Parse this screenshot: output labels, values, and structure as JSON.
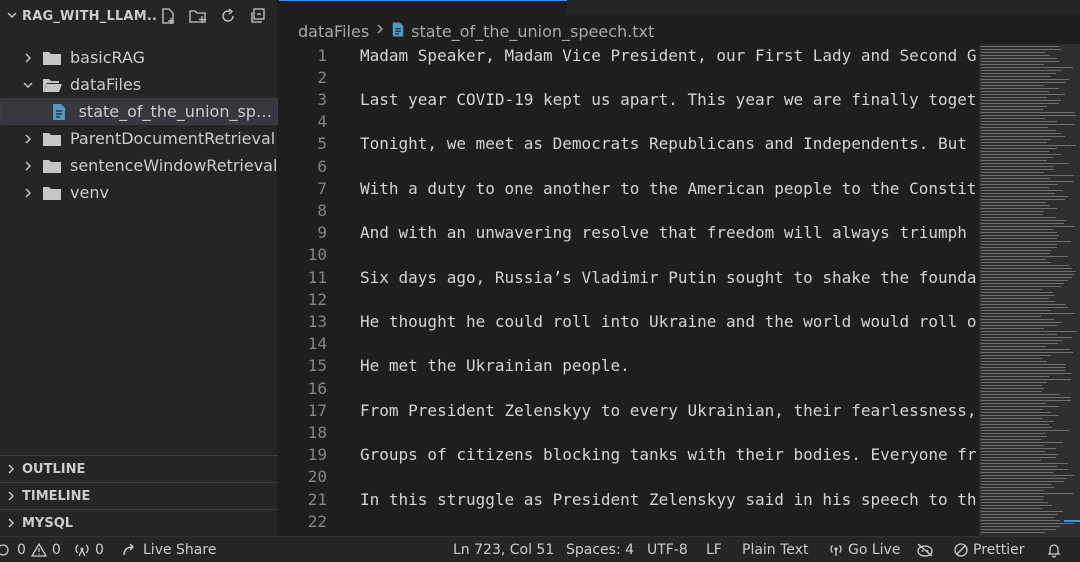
{
  "explorer": {
    "title": "RAG_WITH_LLAM...",
    "items": [
      {
        "label": "basicRAG",
        "type": "folder",
        "expanded": false
      },
      {
        "label": "dataFiles",
        "type": "folder",
        "expanded": true
      },
      {
        "label": "state_of_the_union_spe...",
        "type": "file",
        "selected": true
      },
      {
        "label": "ParentDocumentRetrieval",
        "type": "folder",
        "expanded": false
      },
      {
        "label": "sentenceWindowRetrieval",
        "type": "folder",
        "expanded": false
      },
      {
        "label": "venv",
        "type": "folder",
        "expanded": false
      }
    ]
  },
  "panels": {
    "outline": "OUTLINE",
    "timeline": "TIMELINE",
    "mysql": "MYSQL"
  },
  "breadcrumb": {
    "folder": "dataFiles",
    "file": "state_of_the_union_speech.txt"
  },
  "editor": {
    "lines": [
      {
        "n": "1",
        "text": "Madam Speaker, Madam Vice President, our First Lady and Second G"
      },
      {
        "n": "2",
        "text": ""
      },
      {
        "n": "3",
        "text": "Last year COVID-19 kept us apart. This year we are finally toget"
      },
      {
        "n": "4",
        "text": ""
      },
      {
        "n": "5",
        "text": "Tonight, we meet as Democrats Republicans and Independents. But"
      },
      {
        "n": "6",
        "text": ""
      },
      {
        "n": "7",
        "text": "With a duty to one another to the American people to the Constit"
      },
      {
        "n": "8",
        "text": ""
      },
      {
        "n": "9",
        "text": "And with an unwavering resolve that freedom will always triumph"
      },
      {
        "n": "10",
        "text": ""
      },
      {
        "n": "11",
        "text": "Six days ago, Russia’s Vladimir Putin sought to shake the founda"
      },
      {
        "n": "12",
        "text": ""
      },
      {
        "n": "13",
        "text": "He thought he could roll into Ukraine and the world would roll o"
      },
      {
        "n": "14",
        "text": ""
      },
      {
        "n": "15",
        "text": "He met the Ukrainian people."
      },
      {
        "n": "16",
        "text": ""
      },
      {
        "n": "17",
        "text": "From President Zelenskyy to every Ukrainian, their fearlessness,"
      },
      {
        "n": "18",
        "text": ""
      },
      {
        "n": "19",
        "text": "Groups of citizens blocking tanks with their bodies. Everyone fr"
      },
      {
        "n": "20",
        "text": ""
      },
      {
        "n": "21",
        "text": "In this struggle as President Zelenskyy said in his speech to th"
      },
      {
        "n": "22",
        "text": ""
      }
    ]
  },
  "status": {
    "errors": "0",
    "warnings": "0",
    "ports": "0",
    "live_share": "Live Share",
    "position": "Ln 723, Col 51",
    "spaces": "Spaces: 4",
    "encoding": "UTF-8",
    "eol": "LF",
    "language": "Plain Text",
    "go_live": "Go Live",
    "prettier": "Prettier"
  },
  "colors": {
    "accent": "#3794ff",
    "folder": "#c5c5c5",
    "file_icon": "#519aba"
  }
}
